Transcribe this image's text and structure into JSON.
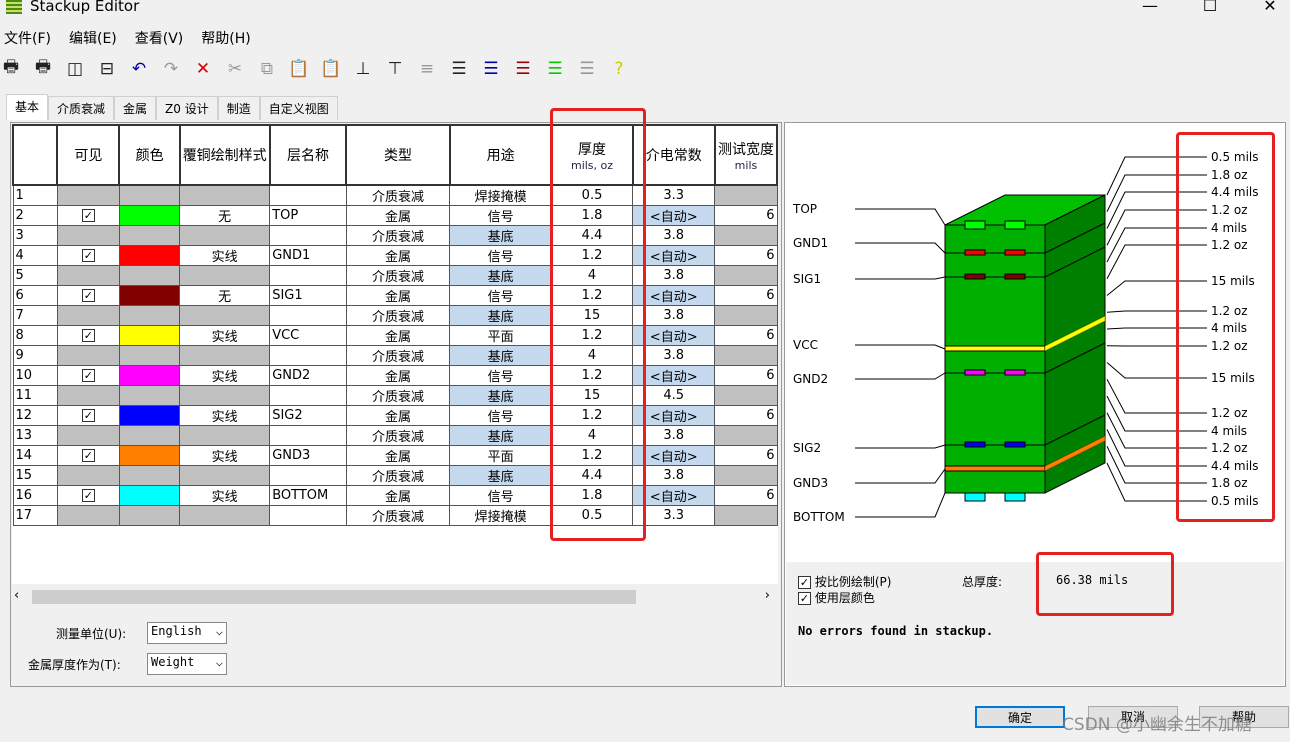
{
  "window": {
    "title": "Stackup Editor",
    "minimize": "—",
    "maximize": "☐",
    "close": "✕"
  },
  "menu": [
    "文件(F)",
    "编辑(E)",
    "查看(V)",
    "帮助(H)"
  ],
  "toolbar_icons": [
    "print-preview-icon",
    "print-icon",
    "split-vertical-icon",
    "split-horizontal-icon",
    "undo-icon",
    "redo-icon",
    "delete-icon",
    "cut-icon",
    "copy-icon",
    "paste-special-icon",
    "paste-icon",
    "insert-above-icon",
    "insert-below-icon",
    "sort-icon",
    "layer-lock-icon",
    "layers-blue-icon",
    "layers-red-icon",
    "layers-green-icon",
    "layers-gray-icon",
    "help-icon"
  ],
  "tabs": [
    "基本",
    "介质衰减",
    "金属",
    "Z0 设计",
    "制造",
    "自定义视图"
  ],
  "columns": [
    {
      "label": "",
      "unit": ""
    },
    {
      "label": "可见",
      "unit": ""
    },
    {
      "label": "颜色",
      "unit": ""
    },
    {
      "label": "覆铜绘制样式",
      "unit": ""
    },
    {
      "label": "层名称",
      "unit": ""
    },
    {
      "label": "类型",
      "unit": ""
    },
    {
      "label": "用途",
      "unit": ""
    },
    {
      "label": "厚度",
      "unit": "mils, oz"
    },
    {
      "label": "介电常数",
      "unit": ""
    },
    {
      "label": "测试宽度",
      "unit": "mils"
    }
  ],
  "rows": [
    {
      "n": "1",
      "vis": false,
      "color": "",
      "style": "",
      "name": "",
      "type": "介质衰减",
      "use": "焊接掩模",
      "thick": "0.5",
      "er": "3.3",
      "width": ""
    },
    {
      "n": "2",
      "vis": true,
      "color": "#00ff00",
      "style": "无",
      "name": "TOP",
      "type": "金属",
      "use": "信号",
      "thick": "1.8",
      "er": "<自动>",
      "width": "6"
    },
    {
      "n": "3",
      "vis": false,
      "color": "",
      "style": "",
      "name": "",
      "type": "介质衰减",
      "use": "基底",
      "thick": "4.4",
      "er": "3.8",
      "width": ""
    },
    {
      "n": "4",
      "vis": true,
      "color": "#ff0000",
      "style": "实线",
      "name": "GND1",
      "type": "金属",
      "use": "信号",
      "thick": "1.2",
      "er": "<自动>",
      "width": "6"
    },
    {
      "n": "5",
      "vis": false,
      "color": "",
      "style": "",
      "name": "",
      "type": "介质衰减",
      "use": "基底",
      "thick": "4",
      "er": "3.8",
      "width": ""
    },
    {
      "n": "6",
      "vis": true,
      "color": "#800000",
      "style": "无",
      "name": "SIG1",
      "type": "金属",
      "use": "信号",
      "thick": "1.2",
      "er": "<自动>",
      "width": "6"
    },
    {
      "n": "7",
      "vis": false,
      "color": "",
      "style": "",
      "name": "",
      "type": "介质衰减",
      "use": "基底",
      "thick": "15",
      "er": "3.8",
      "width": ""
    },
    {
      "n": "8",
      "vis": true,
      "color": "#ffff00",
      "style": "实线",
      "name": "VCC",
      "type": "金属",
      "use": "平面",
      "thick": "1.2",
      "er": "<自动>",
      "width": "6"
    },
    {
      "n": "9",
      "vis": false,
      "color": "",
      "style": "",
      "name": "",
      "type": "介质衰减",
      "use": "基底",
      "thick": "4",
      "er": "3.8",
      "width": ""
    },
    {
      "n": "10",
      "vis": true,
      "color": "#ff00ff",
      "style": "实线",
      "name": "GND2",
      "type": "金属",
      "use": "信号",
      "thick": "1.2",
      "er": "<自动>",
      "width": "6"
    },
    {
      "n": "11",
      "vis": false,
      "color": "",
      "style": "",
      "name": "",
      "type": "介质衰减",
      "use": "基底",
      "thick": "15",
      "er": "4.5",
      "width": ""
    },
    {
      "n": "12",
      "vis": true,
      "color": "#0000ff",
      "style": "实线",
      "name": "SIG2",
      "type": "金属",
      "use": "信号",
      "thick": "1.2",
      "er": "<自动>",
      "width": "6"
    },
    {
      "n": "13",
      "vis": false,
      "color": "",
      "style": "",
      "name": "",
      "type": "介质衰减",
      "use": "基底",
      "thick": "4",
      "er": "3.8",
      "width": ""
    },
    {
      "n": "14",
      "vis": true,
      "color": "#ff8000",
      "style": "实线",
      "name": "GND3",
      "type": "金属",
      "use": "平面",
      "thick": "1.2",
      "er": "<自动>",
      "width": "6"
    },
    {
      "n": "15",
      "vis": false,
      "color": "",
      "style": "",
      "name": "",
      "type": "介质衰减",
      "use": "基底",
      "thick": "4.4",
      "er": "3.8",
      "width": ""
    },
    {
      "n": "16",
      "vis": true,
      "color": "#00ffff",
      "style": "实线",
      "name": "BOTTOM",
      "type": "金属",
      "use": "信号",
      "thick": "1.8",
      "er": "<自动>",
      "width": "6"
    },
    {
      "n": "17",
      "vis": false,
      "color": "",
      "style": "",
      "name": "",
      "type": "介质衰减",
      "use": "焊接掩模",
      "thick": "0.5",
      "er": "3.3",
      "width": ""
    }
  ],
  "units": {
    "label": "测量单位(U):",
    "value": "English"
  },
  "metal_thickness": {
    "label": "金属厚度作为(T):",
    "value": "Weight"
  },
  "diagram": {
    "layer_labels": [
      "TOP",
      "GND1",
      "SIG1",
      "VCC",
      "GND2",
      "SIG2",
      "GND3",
      "BOTTOM"
    ],
    "thickness_labels": [
      "0.5 mils",
      "1.8 oz",
      "4.4 mils",
      "1.2 oz",
      "4 mils",
      "1.2 oz",
      "15 mils",
      "1.2 oz",
      "4 mils",
      "1.2 oz",
      "15 mils",
      "1.2 oz",
      "4 mils",
      "1.2 oz",
      "4.4 mils",
      "1.8 oz",
      "0.5 mils"
    ],
    "substrate_color": "#00b000"
  },
  "options": {
    "scale": "按比例绘制(P)",
    "use_colors": "使用层颜色"
  },
  "total": {
    "label": "总厚度:",
    "value": "66.38 mils"
  },
  "message": "No errors found in stackup.",
  "buttons": {
    "ok": "确定",
    "cancel": "取消",
    "help": "帮助"
  },
  "watermark": "CSDN @小幽余生不加糖"
}
